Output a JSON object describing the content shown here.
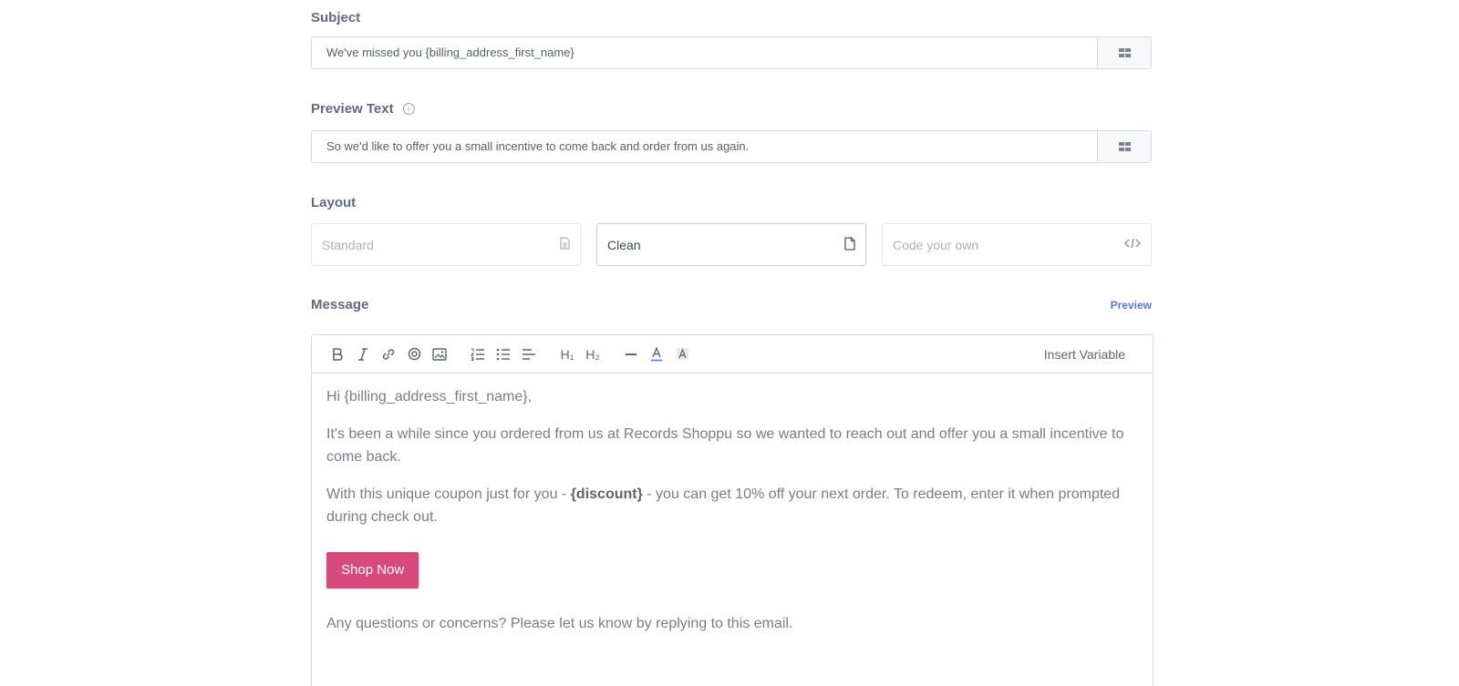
{
  "subject": {
    "label": "Subject",
    "value": "We've missed you {billing_address_first_name}"
  },
  "preview_text": {
    "label": "Preview Text",
    "info": "i",
    "value": "So we'd like to offer you a small incentive to come back and order from us again."
  },
  "layout": {
    "label": "Layout",
    "options": [
      {
        "label": "Standard",
        "icon": "document-lines-icon",
        "selected": false
      },
      {
        "label": "Clean",
        "icon": "document-icon",
        "selected": true
      },
      {
        "label": "Code your own",
        "icon": "code-icon",
        "selected": false
      }
    ]
  },
  "message": {
    "label": "Message",
    "preview_link": "Preview",
    "toolbar": {
      "insert_variable": "Insert Variable",
      "h1": "H₁",
      "h2": "H₂"
    },
    "body": {
      "greeting": "Hi {billing_address_first_name},",
      "para1": "It's been a while since you ordered from us at Records Shoppu so we wanted to reach out and offer you a small incentive to come back.",
      "para2_before": "With this unique coupon just for you - ",
      "para2_bold": "{discount}",
      "para2_after": " - you can get 10% off your next order. To redeem, enter it when prompted during check out.",
      "button": "Shop Now",
      "closing": "Any questions or concerns? Please let us know by replying to this email."
    }
  },
  "colors": {
    "accent_button": "#d94a7c",
    "link": "#4f7ae5"
  }
}
